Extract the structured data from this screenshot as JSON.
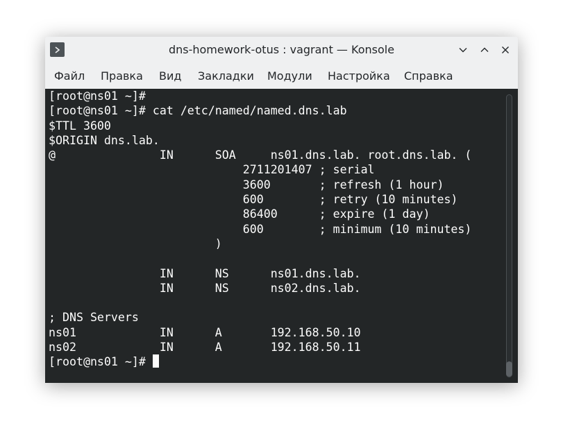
{
  "window": {
    "title": "dns-homework-otus : vagrant — Konsole",
    "icon": "terminal-icon",
    "controls": [
      "chevron-down-icon",
      "chevron-up-icon",
      "close-icon"
    ]
  },
  "menu": {
    "items": [
      "Файл",
      "Правка",
      "Вид",
      "Закладки",
      "Модули",
      "Настройка",
      "Справка"
    ]
  },
  "terminal": {
    "lines": [
      "[root@ns01 ~]#",
      "[root@ns01 ~]# cat /etc/named/named.dns.lab",
      "$TTL 3600",
      "$ORIGIN dns.lab.",
      "@               IN      SOA     ns01.dns.lab. root.dns.lab. (",
      "                            2711201407 ; serial",
      "                            3600       ; refresh (1 hour)",
      "                            600        ; retry (10 minutes)",
      "                            86400      ; expire (1 day)",
      "                            600        ; minimum (10 minutes)",
      "                        )",
      "",
      "                IN      NS      ns01.dns.lab.",
      "                IN      NS      ns02.dns.lab.",
      "",
      "; DNS Servers",
      "ns01            IN      A       192.168.50.10",
      "ns02            IN      A       192.168.50.11"
    ],
    "prompt": "[root@ns01 ~]# "
  },
  "colors": {
    "terminal_bg": "#232627",
    "terminal_fg": "#fcfcfc",
    "chrome_bg": "#eff0f1",
    "text": "#232629"
  }
}
